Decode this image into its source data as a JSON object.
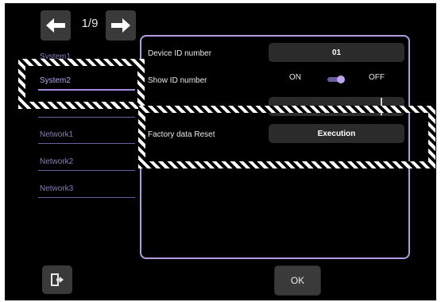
{
  "header": {
    "page_indicator": "1/9"
  },
  "sidebar": {
    "items": [
      {
        "label": "System1"
      },
      {
        "label": "System2"
      },
      {
        "label": ""
      },
      {
        "label": "Network1"
      },
      {
        "label": "Network2"
      },
      {
        "label": "Network3"
      }
    ],
    "active_item": "System2"
  },
  "settings": {
    "device_id": {
      "label": "Device ID number",
      "value": "01"
    },
    "show_id": {
      "label": "Show ID number",
      "on_label": "ON",
      "off_label": "OFF",
      "state": "ON"
    },
    "obscured_row": {
      "label": "",
      "value": ""
    },
    "factory_reset": {
      "label": "Factory data Reset",
      "button_label": "Execution"
    }
  },
  "footer": {
    "ok_label": "OK"
  },
  "colors": {
    "background": "#000000",
    "accent": "#b49be0",
    "button_bg": "#3a3a3a",
    "field_bg": "#2b2b2b"
  },
  "icons": {
    "prev": "arrow-left-icon",
    "next": "arrow-right-icon",
    "exit": "exit-door-icon"
  }
}
